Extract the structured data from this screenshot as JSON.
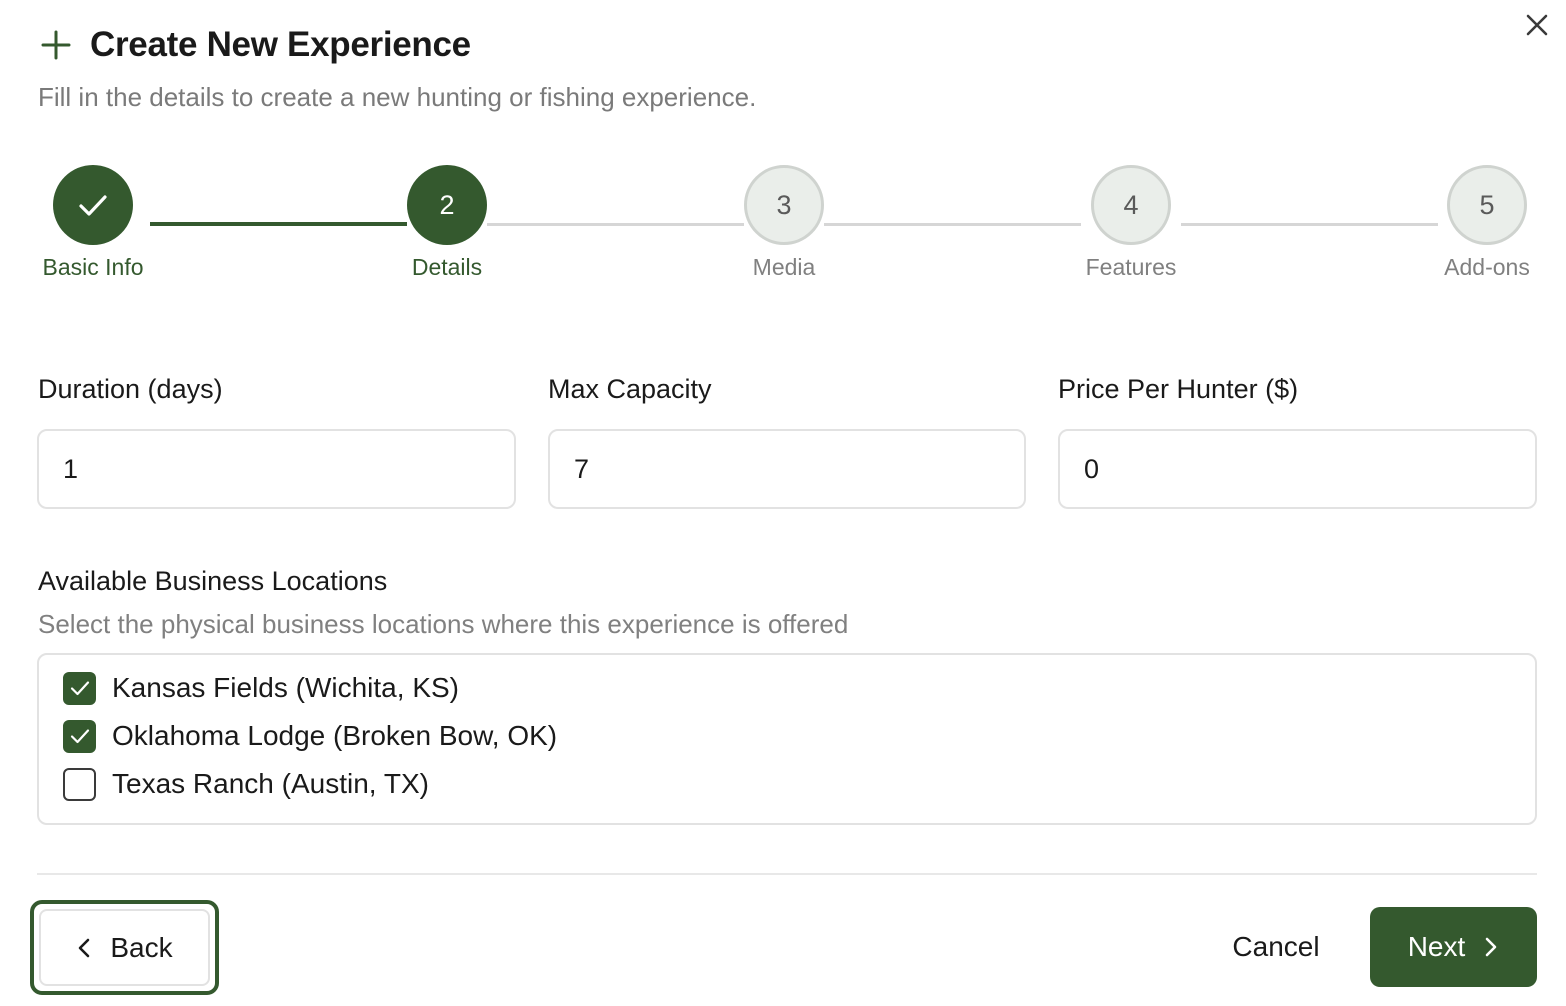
{
  "dialog": {
    "title": "Create New Experience",
    "subtitle": "Fill in the details to create a new hunting or fishing experience."
  },
  "colors": {
    "accent": "#34592e",
    "pending_step_bg": "#eaeeea",
    "muted_text": "#808080"
  },
  "stepper": {
    "current_step": 2,
    "steps": [
      {
        "number": "1",
        "label": "Basic Info",
        "status": "complete"
      },
      {
        "number": "2",
        "label": "Details",
        "status": "active"
      },
      {
        "number": "3",
        "label": "Media",
        "status": "pending"
      },
      {
        "number": "4",
        "label": "Features",
        "status": "pending"
      },
      {
        "number": "5",
        "label": "Add-ons",
        "status": "pending"
      }
    ]
  },
  "fields": {
    "duration": {
      "label": "Duration (days)",
      "value": "1"
    },
    "capacity": {
      "label": "Max Capacity",
      "value": "7"
    },
    "price": {
      "label": "Price Per Hunter ($)",
      "value": "0"
    }
  },
  "locations": {
    "label": "Available Business Locations",
    "help": "Select the physical business locations where this experience is offered",
    "items": [
      {
        "label": "Kansas Fields (Wichita, KS)",
        "checked": true
      },
      {
        "label": "Oklahoma Lodge (Broken Bow, OK)",
        "checked": true
      },
      {
        "label": "Texas Ranch (Austin, TX)",
        "checked": false
      }
    ]
  },
  "footer": {
    "back_label": "Back",
    "cancel_label": "Cancel",
    "next_label": "Next"
  }
}
